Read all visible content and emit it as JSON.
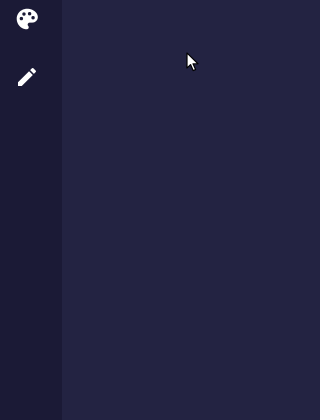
{
  "colors": {
    "sidebar_bg": "#1b1a36",
    "main_bg": "#232342",
    "icon": "#ffffff"
  },
  "sidebar": {
    "tools": [
      {
        "icon": "palette-icon"
      },
      {
        "icon": "pencil-icon"
      }
    ]
  }
}
